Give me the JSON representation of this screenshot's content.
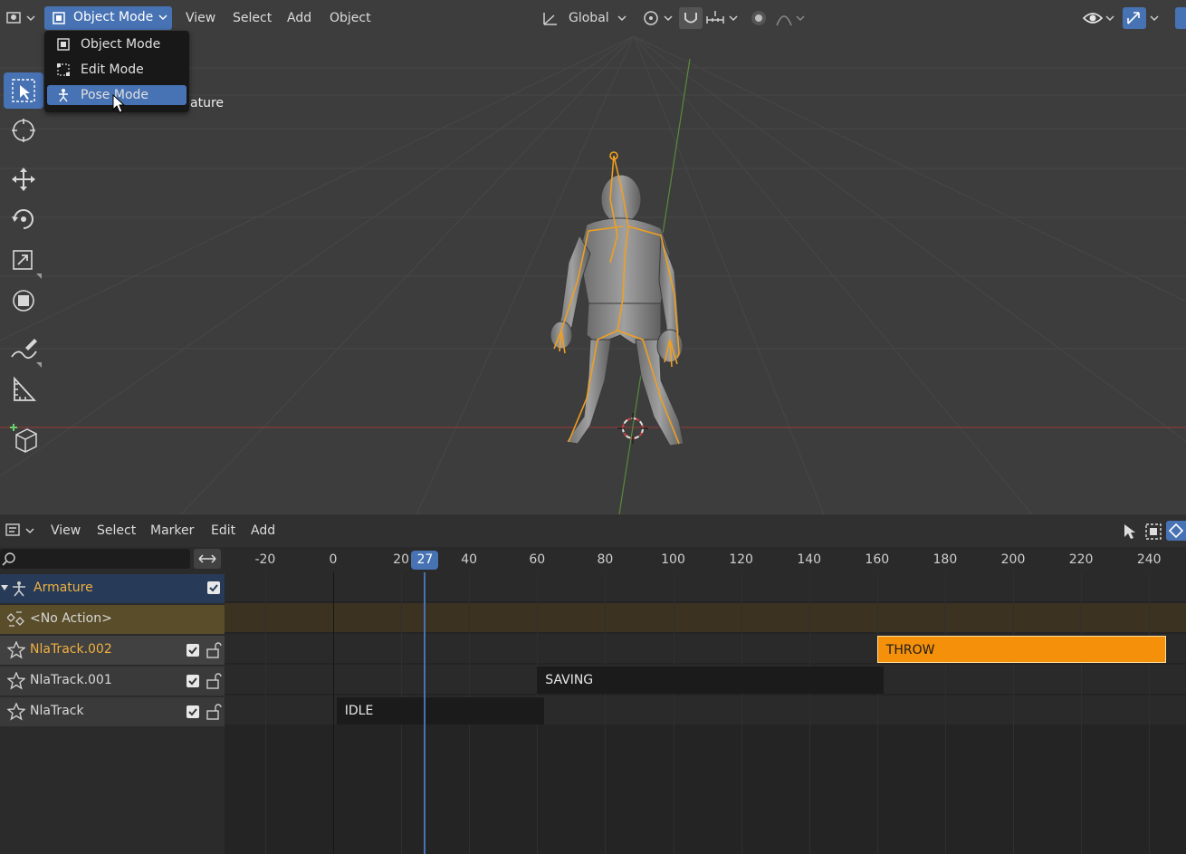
{
  "viewport": {
    "header": {
      "mode": "Object Mode",
      "menus": [
        "View",
        "Select",
        "Add",
        "Object"
      ],
      "orientation": "Global"
    },
    "mode_menu": {
      "items": [
        {
          "label": "Object Mode",
          "icon": "object-mode-icon"
        },
        {
          "label": "Edit Mode",
          "icon": "edit-mode-icon"
        },
        {
          "label": "Pose Mode",
          "icon": "pose-mode-icon",
          "selected": true
        }
      ]
    },
    "object_info_partial": "ature",
    "tools": [
      "select-box-icon",
      "cursor-icon",
      "move-icon",
      "rotate-icon",
      "scale-icon",
      "transform-icon",
      "annotate-icon",
      "measure-icon",
      "add-cube-icon"
    ]
  },
  "nla": {
    "header": {
      "menus": [
        "View",
        "Select",
        "Marker",
        "Edit",
        "Add"
      ]
    },
    "search_placeholder": "",
    "current_frame": "27",
    "ruler_ticks": [
      "-20",
      "0",
      "20",
      "40",
      "60",
      "80",
      "100",
      "120",
      "140",
      "160",
      "180",
      "200",
      "220",
      "240"
    ],
    "channels": [
      {
        "label": "Armature",
        "kind": "object"
      },
      {
        "label": "<No Action>",
        "kind": "action"
      },
      {
        "label": "NlaTrack.002",
        "kind": "track",
        "active": true
      },
      {
        "label": "NlaTrack.001",
        "kind": "track"
      },
      {
        "label": "NlaTrack",
        "kind": "track"
      }
    ],
    "strips": [
      {
        "name": "THROW",
        "start": 160,
        "end": 245,
        "track": 0,
        "color": "#f5900a",
        "text_color": "#1a1a1a"
      },
      {
        "name": "SAVING",
        "start": 60,
        "end": 162,
        "track": 1,
        "color": "#1b1b1b",
        "text_color": "#e8e8e8"
      },
      {
        "name": "IDLE",
        "start": 1,
        "end": 62,
        "track": 2,
        "color": "#1b1b1b",
        "text_color": "#e8e8e8"
      }
    ]
  },
  "colors": {
    "accent": "#4772b3",
    "bone": "#f0a020",
    "strip_active": "#f5900a"
  }
}
